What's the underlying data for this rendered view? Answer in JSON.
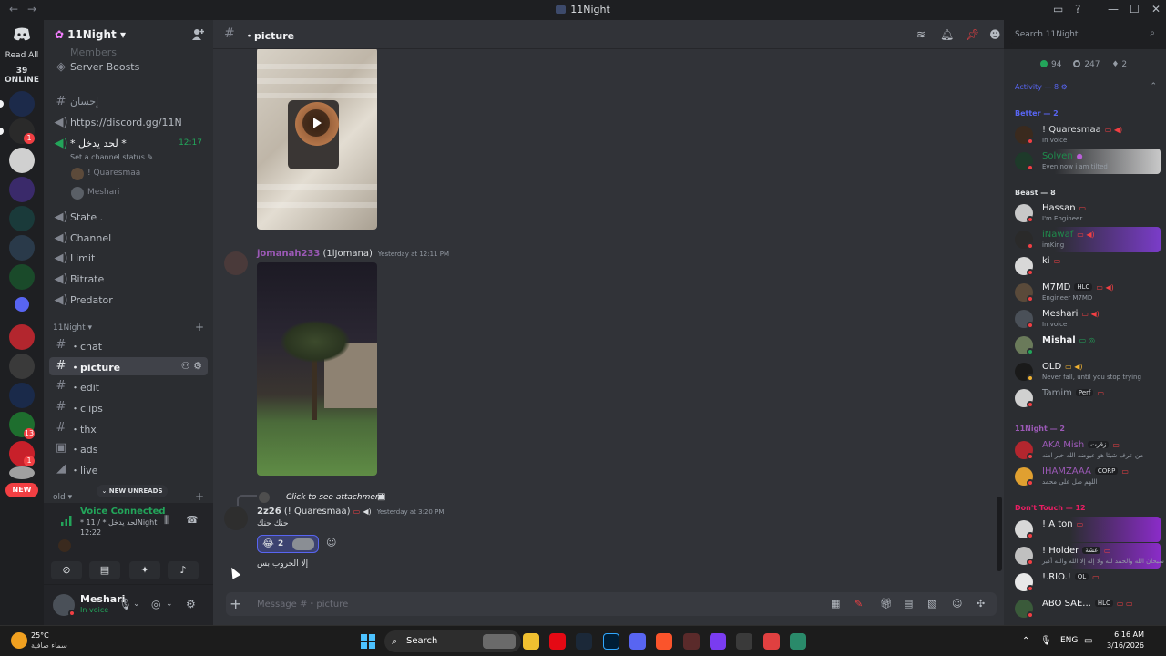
{
  "window": {
    "title": "11Night"
  },
  "rail": {
    "read_all": "Read All",
    "online": "39 ONLINE",
    "badges": [
      "1",
      "13",
      "1"
    ],
    "new_label": "NEW"
  },
  "guild": {
    "name": "11Night"
  },
  "sidebar": {
    "partial_top": "Members",
    "items": [
      {
        "label": "Server Boosts",
        "icon": "boost-icon"
      },
      {
        "label": "إحسان",
        "icon": "hash-icon"
      },
      {
        "label": "https://discord.gg/11N",
        "icon": "voice-icon"
      },
      {
        "label": "* لحد يدخل *",
        "icon": "voice-icon",
        "timer": "12:17"
      },
      {
        "label": "State .",
        "icon": "voice-icon"
      },
      {
        "label": "Channel",
        "icon": "voice-icon"
      },
      {
        "label": "Limit",
        "icon": "voice-icon"
      },
      {
        "label": "Bitrate",
        "icon": "voice-icon"
      },
      {
        "label": "Predator",
        "icon": "voice-icon"
      }
    ],
    "channel_status": "Set a channel status",
    "voice_users": [
      "! Quaresmaa",
      "Meshari"
    ],
    "category": "11Night",
    "text_channels": [
      {
        "label": "・chat"
      },
      {
        "label": "・picture"
      },
      {
        "label": "・edit"
      },
      {
        "label": "・clips"
      },
      {
        "label": "・thx"
      },
      {
        "label": "・ads"
      },
      {
        "label": "・live"
      }
    ],
    "category2": "old",
    "new_unreads": "NEW UNREADS"
  },
  "voice_panel": {
    "title": "Voice Connected",
    "channel": "* لحد يدخل * / 11Night",
    "time": "12:22"
  },
  "user_panel": {
    "name": "Meshari",
    "status": "In voice"
  },
  "chat": {
    "channel_name": "・picture",
    "search_placeholder": "Search 11Night",
    "composer_placeholder": "Message #・picture",
    "messages": [
      {
        "author": "jomanah233",
        "nickname": "(1lJomana)",
        "time": "Yesterday at 12:11 PM",
        "author_color": "#9b59b6"
      },
      {
        "reply_text": "Click to see attachment",
        "author": "2z26",
        "nickname": "(! Quaresmaa)",
        "time": "Yesterday at 3:20 PM",
        "author_color": "#dbdee1",
        "line1": "حنك حنك",
        "reaction_emoji": "😂",
        "reaction_count": "2",
        "line2": "إلا الحروب بس"
      }
    ]
  },
  "members": {
    "online": "94",
    "idle": "247",
    "boost": "2",
    "activity": "Activity — 8",
    "groups": [
      {
        "title": "Better — 2",
        "color": "#5865f2",
        "members": [
          {
            "name": "! Quaresmaa",
            "sub": "In voice",
            "color": "#dbdee1"
          },
          {
            "name": "Solven",
            "sub": "Even now i am tilted",
            "color": "#1f8b4c"
          }
        ]
      },
      {
        "title": "Beast — 8",
        "color": "#dbdee1",
        "members": [
          {
            "name": "Hassan",
            "sub": "I'm Engineer",
            "color": "#f2f3f5"
          },
          {
            "name": "iNawaf",
            "sub": "imKing",
            "color": "#1f8b4c"
          },
          {
            "name": "ki",
            "sub": "",
            "color": "#f2f3f5"
          },
          {
            "name": "M7MD",
            "tag": "HLC",
            "sub": "Engineer M7MD",
            "color": "#f2f3f5"
          },
          {
            "name": "Meshari",
            "sub": "In voice",
            "color": "#f2f3f5"
          },
          {
            "name": "Mishal",
            "sub": "",
            "color": "#f2f3f5"
          },
          {
            "name": "OLD",
            "sub": "Never fall, until you stop trying",
            "color": "#f2f3f5"
          },
          {
            "name": "Tamim",
            "tag": "Perf",
            "sub": "",
            "color": "#f2f3f5"
          }
        ]
      },
      {
        "title": "11Night — 2",
        "color": "#9b59b6",
        "members": [
          {
            "name": "AKA Mish",
            "tag": "زقرت",
            "sub": "من عرف شيئا هو عيوضه الله خير امنه",
            "color": "#9b59b6"
          },
          {
            "name": "IHAMZAAA",
            "tag": "CORP",
            "sub": "اللهم صل على محمد",
            "color": "#9b59b6"
          }
        ]
      },
      {
        "title": "Don't Touch — 12",
        "color": "#e91e63",
        "members": [
          {
            "name": "! A ton",
            "sub": "",
            "color": "#f2f3f5"
          },
          {
            "name": "! Holder",
            "tag": "غشة",
            "sub": "سبحان الله والحمد لله ولا إله إلا الله والله أكبر",
            "color": "#f2f3f5"
          },
          {
            "name": "!.RIO.!",
            "tag": "OL",
            "sub": "",
            "color": "#f2f3f5"
          },
          {
            "name": "ABO SAE...",
            "tag": "HLC",
            "sub": "",
            "color": "#f2f3f5"
          }
        ]
      }
    ]
  },
  "taskbar": {
    "temp": "25°C",
    "condition": "سماء صافية",
    "search": "Search",
    "lang": "ENG",
    "time": "6:16 AM",
    "date": "3/16/2026"
  }
}
